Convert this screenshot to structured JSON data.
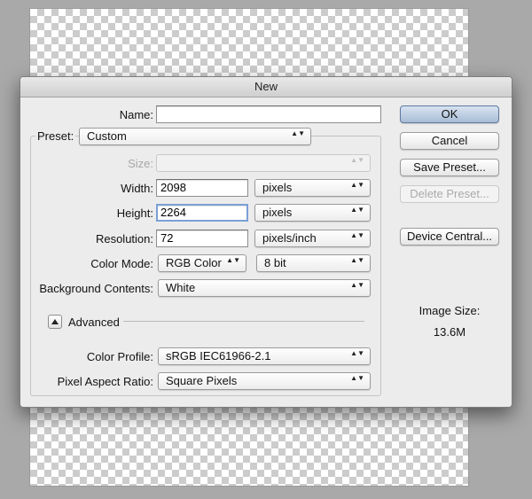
{
  "window": {
    "title": "New"
  },
  "form": {
    "name_label": "Name:",
    "name_value": "",
    "preset_label": "Preset:",
    "preset_value": "Custom",
    "size_label": "Size:",
    "size_value": "",
    "width_label": "Width:",
    "width_value": "2098",
    "width_unit": "pixels",
    "height_label": "Height:",
    "height_value": "2264",
    "height_unit": "pixels",
    "resolution_label": "Resolution:",
    "resolution_value": "72",
    "resolution_unit": "pixels/inch",
    "color_mode_label": "Color Mode:",
    "color_mode_value": "RGB Color",
    "bit_depth_value": "8 bit",
    "background_label": "Background Contents:",
    "background_value": "White",
    "advanced_label": "Advanced",
    "color_profile_label": "Color Profile:",
    "color_profile_value": "sRGB IEC61966-2.1",
    "pixel_aspect_label": "Pixel Aspect Ratio:",
    "pixel_aspect_value": "Square Pixels"
  },
  "buttons": {
    "ok": "OK",
    "cancel": "Cancel",
    "save_preset": "Save Preset...",
    "delete_preset": "Delete Preset...",
    "device_central": "Device Central..."
  },
  "info": {
    "image_size_label": "Image Size:",
    "image_size_value": "13.6M"
  },
  "colors": {
    "default_button": "#a8bdd6",
    "focus_ring": "#7aa0d6"
  }
}
